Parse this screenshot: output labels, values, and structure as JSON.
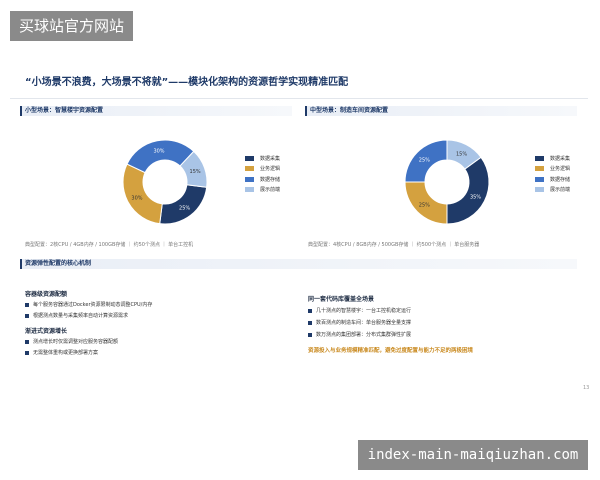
{
  "watermarks": {
    "top": "买球站官方网站",
    "bottom": "index-main-maiqiuzhan.com"
  },
  "slide": {
    "title": "“小场景不浪费，大场景不将就”——模块化架构的资源哲学实现精准匹配",
    "page_number": "13",
    "left_section": {
      "label": "小型场景：智慧楼宇资源配置",
      "config": "典型配置：2核CPU / 4GB内存 / 100GB存储  ｜ 约50个测点  ｜ 单台工控机",
      "legend": [
        "数据采集",
        "业务逻辑",
        "数据存储",
        "展示前端"
      ]
    },
    "right_section": {
      "label": "中型场景：制造车间资源配置",
      "config": "典型配置：4核CPU / 8GB内存 / 500GB存储  ｜ 约500个测点  ｜ 单台服务器",
      "legend": [
        "数据采集",
        "业务逻辑",
        "数据存储",
        "展示前端"
      ]
    },
    "elastic_section": {
      "label": "资源弹性配置的核心机制"
    },
    "left_col": {
      "h1": "容器级资源配额",
      "items1": [
        "每个服务容器通过Docker资源限制动态调整CPU/内存",
        "根据测点数量与采集频率自动计算资源需求"
      ],
      "h2": "渐进式资源增长",
      "items2": [
        "测点增长时仅需调整对应服务容器配额",
        "无需整体重构或更换部署方案"
      ]
    },
    "right_col": {
      "h1": "同一套代码库覆盖全场景",
      "items": [
        "几十测点的智慧楼宇：一台工控机稳定运行",
        "数百测点的制造车间：单台服务器全量支撑",
        "数万测点的集团部署：分布式集群弹性扩展"
      ],
      "highlight": "资源投入与业务规模精准匹配，避免过度配置与能力不足的两极困境"
    }
  },
  "colors": {
    "navy": "#1f3a68",
    "gold": "#d4a13f",
    "blue": "#3f72c4",
    "light": "#a9c4e6"
  },
  "chart_data": [
    {
      "type": "pie",
      "categories": [
        "数据采集",
        "业务逻辑",
        "数据存储",
        "展示前端"
      ],
      "values": [
        25,
        30,
        30,
        15
      ]
    },
    {
      "type": "pie",
      "categories": [
        "数据采集",
        "业务逻辑",
        "数据存储",
        "展示前端"
      ],
      "values": [
        35,
        25,
        25,
        15
      ]
    }
  ]
}
